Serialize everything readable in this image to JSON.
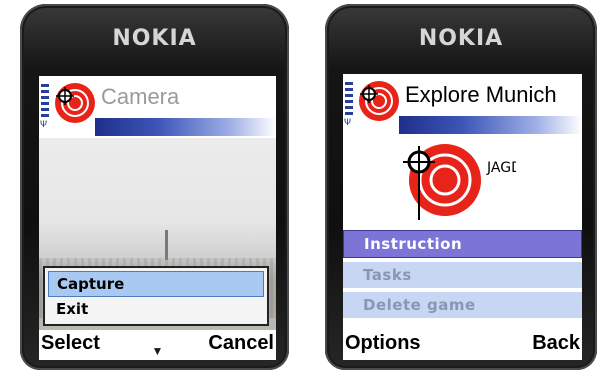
{
  "left_phone": {
    "brand": "NOKIA",
    "app_title": "Camera",
    "popup_menu": {
      "items": [
        "Capture",
        "Exit"
      ],
      "selected_index": 0
    },
    "softkeys": {
      "left": "Select",
      "middle": "▼",
      "right": "Cancel"
    }
  },
  "right_phone": {
    "brand": "NOKIA",
    "app_title": "Explore Munich",
    "logo_text": "JAGD",
    "menu": {
      "items": [
        "Instruction",
        "Tasks",
        "Delete game"
      ],
      "selected_index": 0
    },
    "softkeys": {
      "left": "Options",
      "right": "Back"
    }
  },
  "colors": {
    "accent_blue": "#273f9a",
    "selected_row_purple": "#7c74d6",
    "selected_popup_blue": "#a9c9f2",
    "logo_red": "#e8241a"
  }
}
